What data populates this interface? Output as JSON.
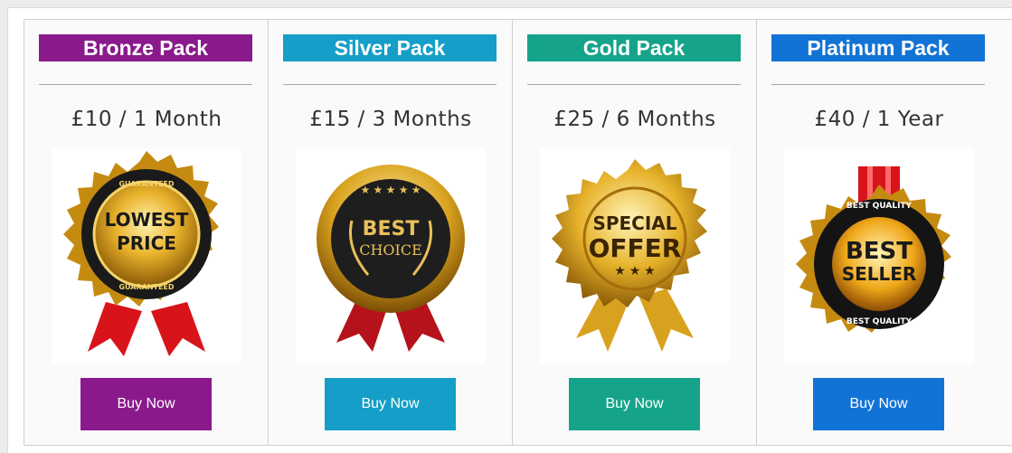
{
  "packs": [
    {
      "title": "Bronze Pack",
      "price": "£10 / 1 Month",
      "button": "Buy Now",
      "color": "#8a1a8c",
      "badge": {
        "line1": "LOWEST",
        "line2": "PRICE",
        "ring_text": "GUARANTEED",
        "icon": "lowest-price-medal-icon"
      }
    },
    {
      "title": "Silver Pack",
      "price": "£15 / 3 Months",
      "button": "Buy Now",
      "color": "#159ec7",
      "badge": {
        "line1": "BEST",
        "line2": "CHOICE",
        "icon": "best-choice-medal-icon"
      }
    },
    {
      "title": "Gold Pack",
      "price": "£25 / 6 Months",
      "button": "Buy Now",
      "color": "#15a48a",
      "badge": {
        "line1": "SPECIAL",
        "line2": "OFFER",
        "icon": "special-offer-medal-icon"
      }
    },
    {
      "title": "Platinum Pack",
      "price": "£40 / 1 Year",
      "button": "Buy Now",
      "color": "#1273d6",
      "badge": {
        "line1": "BEST",
        "line2": "SELLER",
        "ring_text": "BEST QUALITY",
        "icon": "best-seller-medal-icon"
      }
    }
  ]
}
